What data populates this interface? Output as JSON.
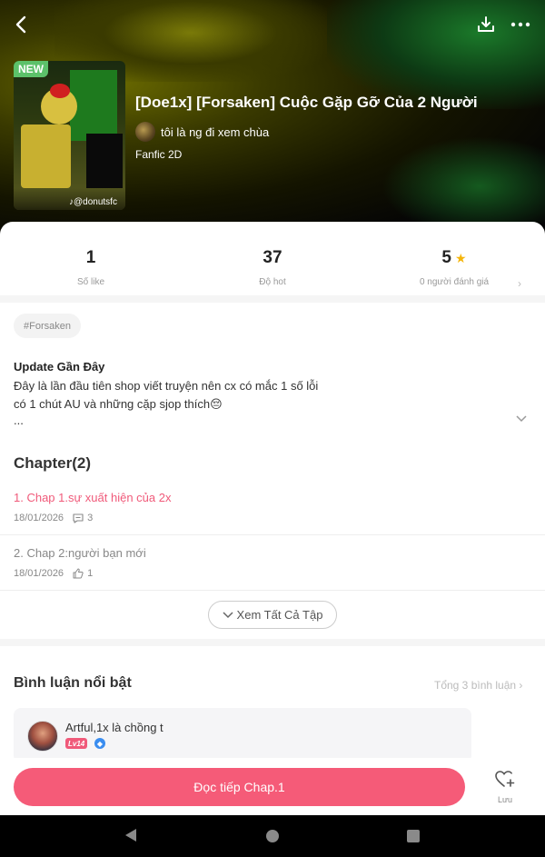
{
  "header": {
    "badge": "NEW",
    "watermark": "♪@donutsfc",
    "title": "[Doe1x] [Forsaken] Cuộc Gặp Gỡ Của 2 Người",
    "author": "tôi là ng đi xem chùa",
    "genre": "Fanfic 2D"
  },
  "stats": {
    "likes": {
      "value": "1",
      "label": "Số like"
    },
    "hot": {
      "value": "37",
      "label": "Độ hot"
    },
    "rating": {
      "value": "5",
      "label": "0 người đánh giá"
    }
  },
  "tags": [
    "#Forsaken"
  ],
  "update": {
    "title": "Update Gần Đây",
    "lines": [
      "Đây là lần đầu tiên shop viết truyện nên cx có mắc 1 số lỗi",
      "có 1 chút AU và những cặp sjop thích😔",
      "..."
    ]
  },
  "chapters": {
    "heading": "Chapter(2)",
    "items": [
      {
        "title": "1. Chap 1.sự xuất hiện của 2x",
        "date": "18/01/2026",
        "count": "3",
        "count_icon": "comment-icon",
        "color": "#f05a7a"
      },
      {
        "title": "2. Chap 2:người bạn mới",
        "date": "18/01/2026",
        "count": "1",
        "count_icon": "thumbs-up-icon",
        "color": "#888888"
      }
    ],
    "see_all": "Xem Tất Cả Tập"
  },
  "comments": {
    "heading": "Bình luận nổi bật",
    "total": "Tổng 3 bình luận",
    "items": [
      {
        "name": "Artful,1x là chồng t",
        "level": "Lv14"
      }
    ]
  },
  "actions": {
    "read": "Đọc tiếp Chap.1",
    "save": "Lưu"
  },
  "colors": {
    "accent": "#f55b78",
    "star": "#f5b50a",
    "new_badge": "#5cc16a"
  }
}
